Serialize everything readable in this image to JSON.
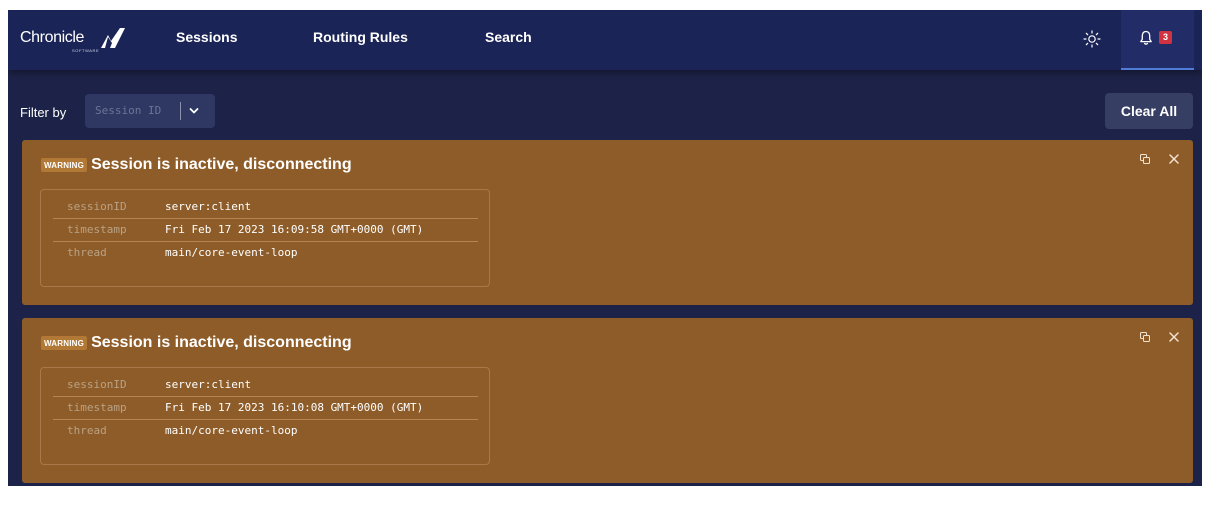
{
  "brand": {
    "name": "Chronicle",
    "subtitle": "SOFTWARE"
  },
  "nav": {
    "items": [
      {
        "label": "Sessions"
      },
      {
        "label": "Routing Rules"
      },
      {
        "label": "Search"
      }
    ],
    "notification_count": "3"
  },
  "filter": {
    "label": "Filter by",
    "placeholder": "Session ID",
    "clear_all_label": "Clear All"
  },
  "notifications": [
    {
      "level": "WARNING",
      "title": "Session is inactive, disconnecting",
      "fields": [
        {
          "key": "sessionID",
          "value": "server:client"
        },
        {
          "key": "timestamp",
          "value": "Fri Feb 17 2023 16:09:58 GMT+0000 (GMT)"
        },
        {
          "key": "thread",
          "value": "main/core-event-loop"
        }
      ]
    },
    {
      "level": "WARNING",
      "title": "Session is inactive, disconnecting",
      "fields": [
        {
          "key": "sessionID",
          "value": "server:client"
        },
        {
          "key": "timestamp",
          "value": "Fri Feb 17 2023 16:10:08 GMT+0000 (GMT)"
        },
        {
          "key": "thread",
          "value": "main/core-event-loop"
        }
      ]
    }
  ],
  "colors": {
    "page_background": "#1d2348",
    "topbar": "#1b2456",
    "active_tab_underline": "#4f7bd9",
    "badge_red": "#d0323f",
    "warning_card": "#8e5c28",
    "warning_badge": "#b17836"
  },
  "icons": {
    "theme": "sun-icon",
    "notifications": "bell-icon",
    "select": "chevron-down-icon",
    "copy": "copy-icon",
    "dismiss": "close-icon"
  }
}
